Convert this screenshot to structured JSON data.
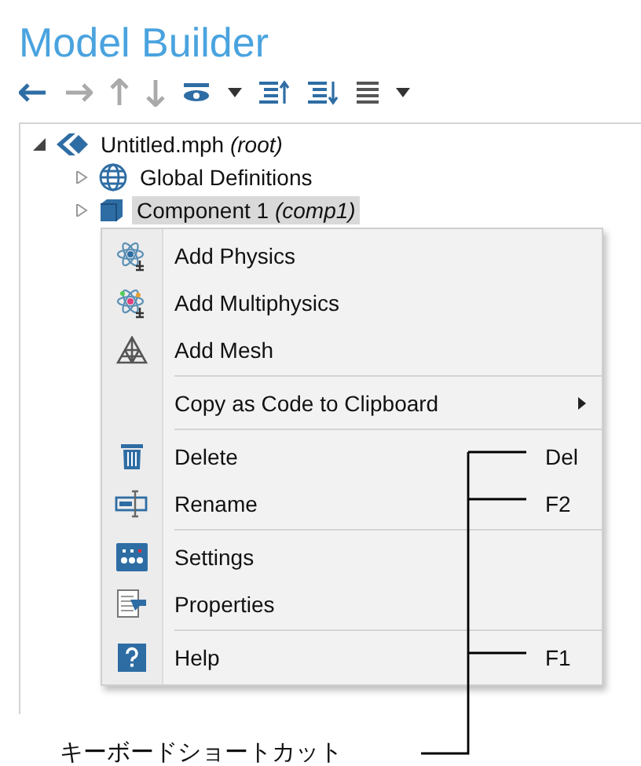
{
  "title": "Model Builder",
  "tree": [
    {
      "label": "Untitled.mph",
      "tag": "(root)",
      "expanded": true,
      "selected": false,
      "children": [
        {
          "label": "Global Definitions",
          "expanded": false,
          "selected": false
        },
        {
          "label": "Component 1",
          "tag": "(comp1)",
          "expanded": false,
          "selected": true
        }
      ]
    }
  ],
  "menu": [
    {
      "kind": "item",
      "label": "Add Physics"
    },
    {
      "kind": "item",
      "label": "Add Multiphysics"
    },
    {
      "kind": "item",
      "label": "Add Mesh"
    },
    {
      "kind": "separator"
    },
    {
      "kind": "submenu",
      "label": "Copy as Code to Clipboard"
    },
    {
      "kind": "separator"
    },
    {
      "kind": "item",
      "label": "Delete",
      "shortcut": "Del"
    },
    {
      "kind": "item",
      "label": "Rename",
      "shortcut": "F2"
    },
    {
      "kind": "separator"
    },
    {
      "kind": "item",
      "label": "Settings"
    },
    {
      "kind": "item",
      "label": "Properties"
    },
    {
      "kind": "separator"
    },
    {
      "kind": "item",
      "label": "Help",
      "shortcut": "F1"
    }
  ],
  "callout": "キーボードショートカット"
}
